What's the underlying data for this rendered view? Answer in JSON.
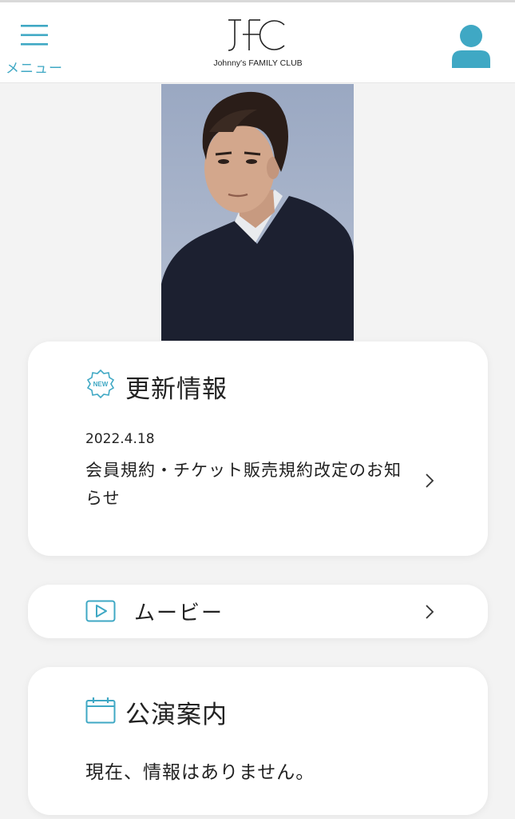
{
  "header": {
    "menu_label": "メニュー",
    "logo_mark": "JFC",
    "logo_text": "Johnny's FAMILY CLUB"
  },
  "hero": {
    "image": "artist-portrait"
  },
  "news": {
    "icon": "new-badge-icon",
    "icon_text": "NEW",
    "title": "更新情報",
    "items": [
      {
        "date": "2022.4.18",
        "text": "会員規約・チケット販売規約改定のお知らせ"
      }
    ]
  },
  "movie": {
    "icon": "play-icon",
    "label": "ムービー"
  },
  "shows": {
    "icon": "calendar-icon",
    "title": "公演案内",
    "empty_text": "現在、情報はありません。"
  },
  "colors": {
    "accent": "#3fa8c4",
    "background": "#f3f3f3",
    "card": "#ffffff",
    "text": "#222222"
  }
}
